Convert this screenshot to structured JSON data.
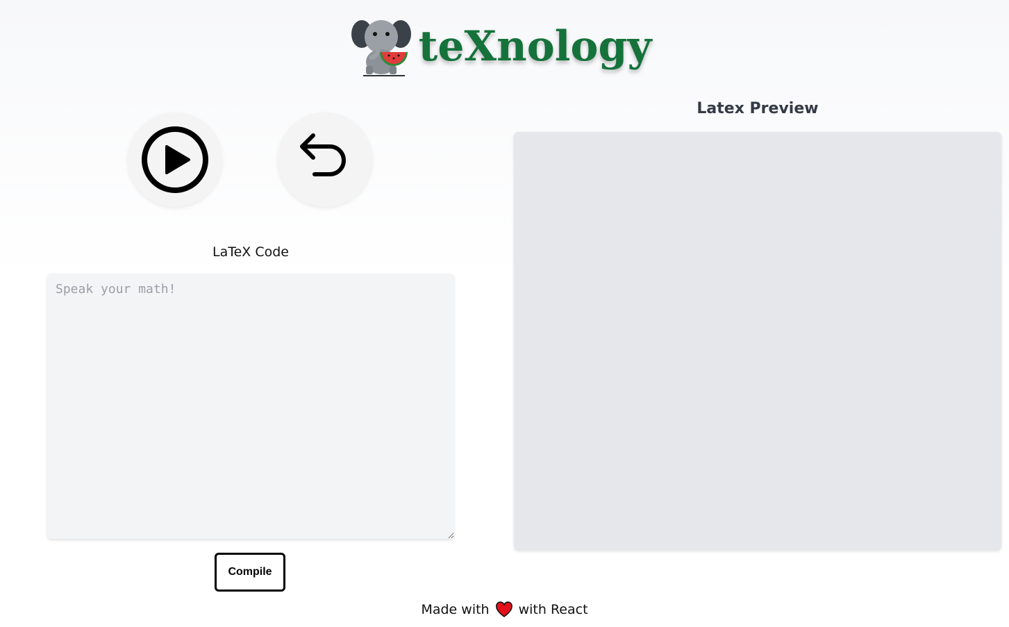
{
  "header": {
    "brand_name": "teXnology",
    "logo_icon": "elephant-eating-watermelon-icon",
    "brand_color": "#15723a"
  },
  "controls": {
    "play_icon": "play-circle-icon",
    "undo_icon": "undo-arrow-icon"
  },
  "editor": {
    "label": "LaTeX Code",
    "placeholder": "Speak your math!",
    "value": "",
    "compile_label": "Compile"
  },
  "preview": {
    "label": "Latex Preview"
  },
  "footer": {
    "text_before": "Made with",
    "heart_icon": "heart-icon",
    "text_after": "with React",
    "heart_color": "#e3101b"
  }
}
